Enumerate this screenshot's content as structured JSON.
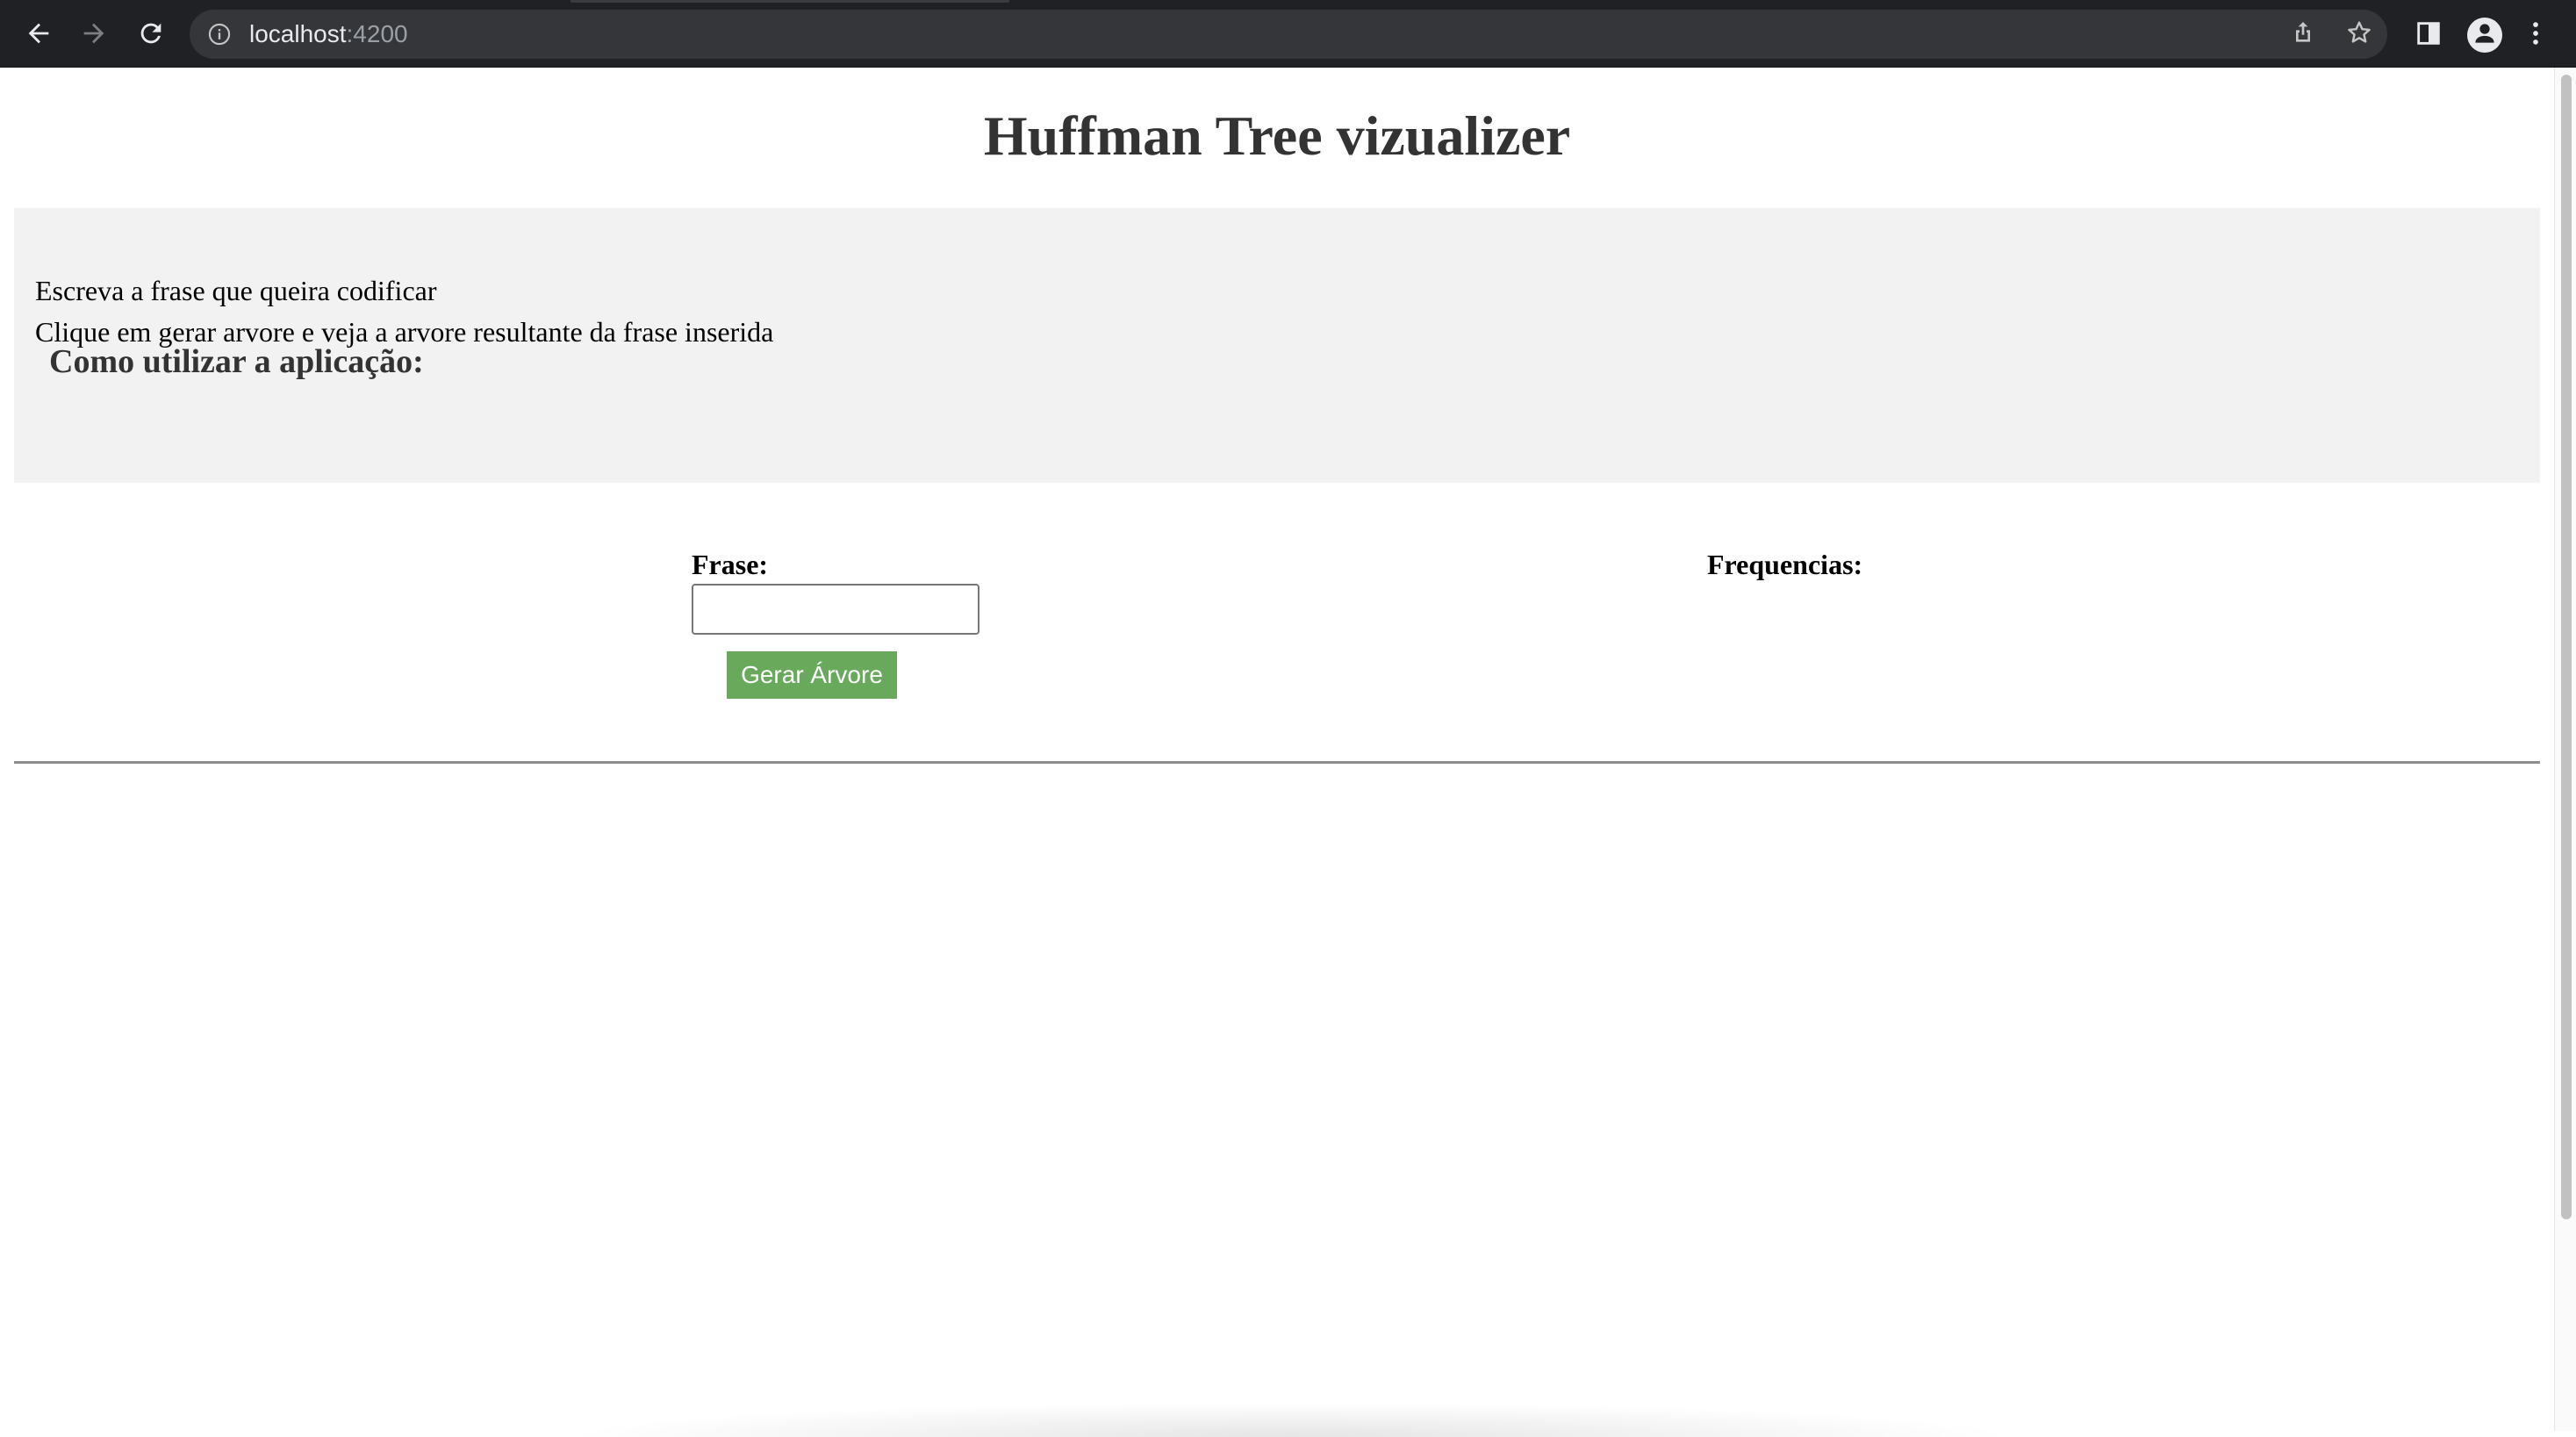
{
  "browser": {
    "url_host": "localhost",
    "url_port": ":4200",
    "icons": {
      "back": "arrow-left-icon",
      "forward": "arrow-right-icon",
      "reload": "reload-icon",
      "site_info": "info-icon",
      "share": "share-icon",
      "bookmark": "star-icon",
      "side_panel": "side-panel-icon",
      "profile": "person-icon",
      "menu": "kebab-menu-icon"
    }
  },
  "page": {
    "title": "Huffman Tree vizualizer",
    "help": {
      "heading": "Como utilizar a aplicação:",
      "lines": [
        "Escreva a frase que queira codificar",
        "Clique em gerar arvore e veja a arvore resultante da frase inserida"
      ]
    },
    "form": {
      "frase_label": "Frase:",
      "frase_value": "",
      "frase_placeholder": "",
      "generate_button_label": "Gerar Árvore"
    },
    "frequencies": {
      "label": "Frequencias:"
    }
  },
  "colors": {
    "chrome_background": "#202124",
    "omnibox_background": "#35363a",
    "help_box_background": "#f2f2f2",
    "heading_text": "#333333",
    "button_green": "#68a95c",
    "divider": "#8c8c8c"
  }
}
